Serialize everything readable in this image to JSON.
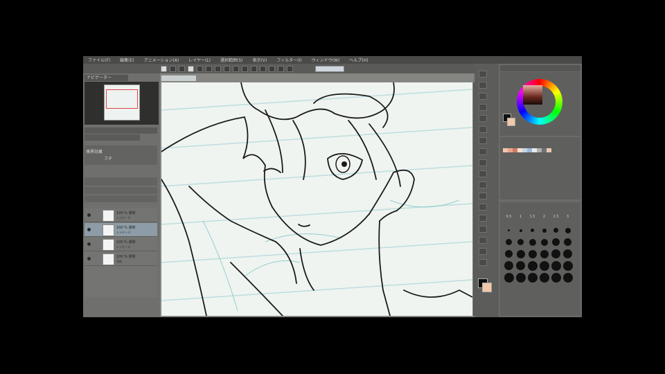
{
  "menu": {
    "items": [
      "ファイル(F)",
      "編集(E)",
      "アニメーション(A)",
      "レイヤー(L)",
      "選択範囲(S)",
      "表示(V)",
      "フィルター(I)",
      "ウィンドウ(W)",
      "ヘルプ(H)"
    ]
  },
  "panels": {
    "navigator_tab": "ナビゲーター",
    "layer_property_title": "境界効果",
    "layer_property_sub": "フチ"
  },
  "layers": [
    {
      "name": "100 % 通常",
      "sub": "レイヤー 4"
    },
    {
      "name": "100 % 通常",
      "sub": "レイヤー 3"
    },
    {
      "name": "100 % 通常",
      "sub": "レイヤー 2"
    },
    {
      "name": "100 % 通常",
      "sub": "用紙"
    }
  ],
  "brush_sizes": [
    "0.5",
    "1",
    "1.5",
    "2",
    "2.5",
    "3"
  ],
  "colors": {
    "foreground": "#0e0e0e",
    "background": "#f1c8a8",
    "canvas": "#eff4f0",
    "app_bg": "#6e6f6c"
  },
  "icons": [
    "eye-icon",
    "pen-tool-icon",
    "eraser-icon",
    "hand-icon",
    "color-wheel"
  ]
}
